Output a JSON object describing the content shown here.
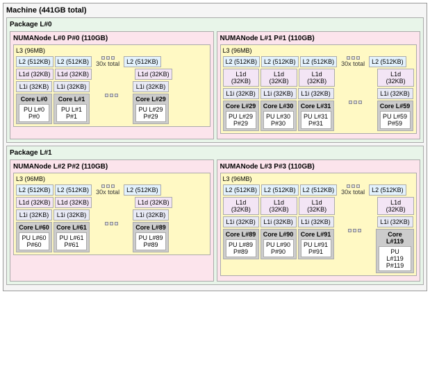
{
  "machine": {
    "title": "Machine (441GB total)",
    "packages": [
      {
        "title": "Package L#0",
        "numas": [
          {
            "title": "NUMANode L#0 P#0 (110GB)",
            "l3": "L3 (96MB)",
            "caches_l2": [
              "L2 (512KB)",
              "L2 (512KB)"
            ],
            "dots": [
              "",
              "",
              ""
            ],
            "dots_label": "30x total",
            "l2_last": "L2 (512KB)",
            "caches_l1d": [
              "L1d (32KB)",
              "L1d (32KB)"
            ],
            "l1d_last": "L1d (32KB)",
            "caches_l1i": [
              "L1i (32KB)",
              "L1i (32KB)"
            ],
            "l1i_last": "L1i (32KB)",
            "cores": [
              {
                "title": "Core L#0",
                "pu": "PU L#0\nP#0"
              },
              {
                "title": "Core L#1",
                "pu": "PU L#1\nP#1"
              }
            ],
            "core_dots": true,
            "core_last": {
              "title": "Core L#29",
              "pu": "PU L#29\nP#29"
            }
          },
          {
            "title": "NUMANode L#1 P#1 (110GB)",
            "l3": "L3 (96MB)",
            "caches_l2": [
              "L2 (512KB)",
              "L2 (512KB)",
              "L2 (512KB)"
            ],
            "dots": [
              "",
              "",
              ""
            ],
            "dots_label": "30x total",
            "l2_last": "L2 (512KB)",
            "caches_l1d": [
              "L1d (32KB)",
              "L1d (32KB)",
              "L1d (32KB)"
            ],
            "l1d_last": "L1d (32KB)",
            "caches_l1i": [
              "L1i (32KB)",
              "L1i (32KB)",
              "L1i (32KB)"
            ],
            "l1i_last": "L1i (32KB)",
            "cores": [
              {
                "title": "Core L#29",
                "pu": "PU L#29\nP#29"
              },
              {
                "title": "Core L#30",
                "pu": "PU L#30\nP#30"
              },
              {
                "title": "Core L#31",
                "pu": "PU L#31\nP#31"
              }
            ],
            "core_dots": true,
            "core_last": {
              "title": "Core L#59",
              "pu": "PU L#59\nP#59"
            }
          }
        ]
      },
      {
        "title": "Package L#1",
        "numas": [
          {
            "title": "NUMANode L#2 P#2 (110GB)",
            "l3": "L3 (96MB)",
            "caches_l2": [
              "L2 (512KB)",
              "L2 (512KB)"
            ],
            "dots": [
              "",
              "",
              ""
            ],
            "dots_label": "30x total",
            "l2_last": "L2 (512KB)",
            "caches_l1d": [
              "L1d (32KB)",
              "L1d (32KB)"
            ],
            "l1d_last": "L1d (32KB)",
            "caches_l1i": [
              "L1i (32KB)",
              "L1i (32KB)"
            ],
            "l1i_last": "L1i (32KB)",
            "cores": [
              {
                "title": "Core L#60",
                "pu": "PU L#60\nP#60"
              },
              {
                "title": "Core L#61",
                "pu": "PU L#61\nP#61"
              }
            ],
            "core_dots": true,
            "core_last": {
              "title": "Core L#89",
              "pu": "PU L#89\nP#89"
            }
          },
          {
            "title": "NUMANode L#3 P#3 (110GB)",
            "l3": "L3 (96MB)",
            "caches_l2": [
              "L2 (512KB)",
              "L2 (512KB)",
              "L2 (512KB)"
            ],
            "dots": [
              "",
              "",
              ""
            ],
            "dots_label": "30x total",
            "l2_last": "L2 (512KB)",
            "caches_l1d": [
              "L1d (32KB)",
              "L1d (32KB)",
              "L1d (32KB)"
            ],
            "l1d_last": "L1d (32KB)",
            "caches_l1i": [
              "L1i (32KB)",
              "L1i (32KB)",
              "L1i (32KB)"
            ],
            "l1i_last": "L1i (32KB)",
            "cores": [
              {
                "title": "Core L#89",
                "pu": "PU L#89\nP#89"
              },
              {
                "title": "Core L#90",
                "pu": "PU L#90\nP#90"
              },
              {
                "title": "Core L#91",
                "pu": "PU L#91\nP#91"
              }
            ],
            "core_dots": true,
            "core_last": {
              "title": "Core L#119",
              "pu": "PU L#119\nP#119"
            }
          }
        ]
      }
    ]
  }
}
